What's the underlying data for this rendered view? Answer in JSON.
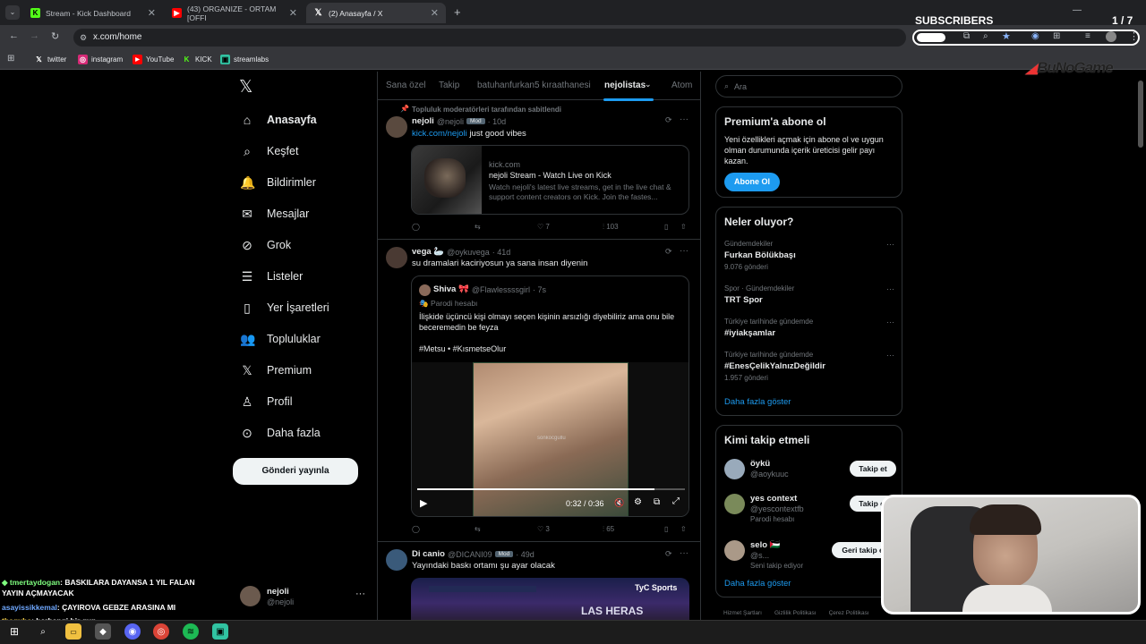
{
  "browser": {
    "tabs": [
      {
        "title": "Stream - Kick Dashboard"
      },
      {
        "title": "(43) ORGANIZE - ORTAM [OFFI"
      },
      {
        "title": "(2) Anasayfa / X"
      }
    ],
    "new_tab": "+",
    "address": "x.com/home",
    "bookmarks": [
      "twitter",
      "instagram",
      "YouTube",
      "KICK",
      "streamlabs"
    ]
  },
  "overlay": {
    "subscribers_label": "SUBSCRIBERS",
    "subscribers_count": "1 / 7",
    "logo_text": "BuNoGame"
  },
  "sidebar": {
    "items": [
      {
        "label": "Anasayfa",
        "icon": "home-icon"
      },
      {
        "label": "Keşfet",
        "icon": "search-icon"
      },
      {
        "label": "Bildirimler",
        "icon": "bell-icon"
      },
      {
        "label": "Mesajlar",
        "icon": "mail-icon"
      },
      {
        "label": "Grok",
        "icon": "grok-icon"
      },
      {
        "label": "Listeler",
        "icon": "list-icon"
      },
      {
        "label": "Yer İşaretleri",
        "icon": "bookmark-icon"
      },
      {
        "label": "Topluluklar",
        "icon": "people-icon"
      },
      {
        "label": "Premium",
        "icon": "x-icon"
      },
      {
        "label": "Profil",
        "icon": "person-icon"
      },
      {
        "label": "Daha fazla",
        "icon": "more-circle-icon"
      }
    ],
    "post_button": "Gönderi yayınla",
    "account": {
      "name": "nejoli",
      "handle": "@nejoli"
    }
  },
  "feed_tabs": [
    "Sana özel",
    "Takip",
    "batuhanfurkan5 kıraathanesi",
    "nejolistas",
    "Atom"
  ],
  "posts": [
    {
      "pinned": "Topluluk moderatörleri tarafından sabitlendi",
      "name": "nejoli",
      "handle": "@nejoli",
      "badge": "Mod",
      "time": "· 10d",
      "text_link": "kick.com/nejoli",
      "text": " just good vibes",
      "card": {
        "domain": "kick.com",
        "title": "nejoli Stream - Watch Live on Kick",
        "desc": "Watch nejoli's latest live streams, get in the live chat & support content creators on Kick. Join the fastes..."
      },
      "likes": "7",
      "views": "103"
    },
    {
      "name": "vega 🦢",
      "handle": "@oykuvega",
      "time": "· 41d",
      "text": "su dramalari kaciriyosun ya sana insan diyenin",
      "quote": {
        "name": "Shiva 🎀",
        "handle": "@Flawlessssgirl",
        "time": "· 7s",
        "label": "Parodi hesabı",
        "text": "İlişkide üçüncü kişi olmayı seçen kişinin arsızlığı diyebiliriz ama onu bile beceremedin be feyza",
        "tags": "#Metsu • #KısmetseOlur",
        "video_time": "0:32 / 0:36",
        "watermark": "sonkocgullu"
      },
      "likes": "3",
      "views": "65"
    },
    {
      "name": "Di canio",
      "handle": "@DICANI09",
      "badge": "Mod",
      "time": "· 49d",
      "text": "Yayındaki baskı ortamı şu ayar olacak",
      "media_overlay": "TyC Sports",
      "media_sign": "LAS HERAS"
    }
  ],
  "search": {
    "placeholder": "Ara"
  },
  "premium": {
    "title": "Premium'a abone ol",
    "text": "Yeni özellikleri açmak için abone ol ve uygun olman durumunda içerik üreticisi gelir payı kazan.",
    "button": "Abone Ol"
  },
  "trends": {
    "title": "Neler oluyor?",
    "items": [
      {
        "category": "Gündemdekiler",
        "title": "Furkan Bölükbaşı",
        "count": "9.076 gönderi"
      },
      {
        "category": "Spor · Gündemdekiler",
        "title": "TRT Spor",
        "count": ""
      },
      {
        "category": "Türkiye tarihinde gündemde",
        "title": "#iyiakşamlar",
        "count": ""
      },
      {
        "category": "Türkiye tarihinde gündemde",
        "title": "#EnesÇelikYalnızDeğildir",
        "count": "1.957 gönderi"
      }
    ],
    "more": "Daha fazla göster"
  },
  "who_to_follow": {
    "title": "Kimi takip etmeli",
    "items": [
      {
        "name": "öykü",
        "handle": "@aoykuuc",
        "button": "Takip et",
        "sub": ""
      },
      {
        "name": "yes context",
        "handle": "@yescontextfb",
        "button": "Takip et",
        "sub": "Parodi hesabı"
      },
      {
        "name": "selo 🇵🇸",
        "handle": "@s...",
        "button": "Geri takip et",
        "sub": "Seni takip ediyor"
      }
    ],
    "more": "Daha fazla göster"
  },
  "footer_links": [
    "Hizmet Şartları",
    "Gizlilik Politikası",
    "Çerez Politikası"
  ],
  "chat": [
    {
      "user": "tmertaydogan",
      "msg": ": BASKILARA DAYANSA 1 YIL FALAN YAYIN AÇMAYACAK",
      "color": "#7fff7f"
    },
    {
      "user": "asayissikkemal",
      "msg": ": ÇAYIROVA GEBZE ARASINA MI",
      "color": "#6fa8ff"
    },
    {
      "user": "theguba",
      "msg": ": herhangi bir gun",
      "color": "#ffd84a"
    }
  ],
  "colors": {
    "accent": "#1d9bf0",
    "kick": "#53fc18",
    "bg": "#000000"
  }
}
